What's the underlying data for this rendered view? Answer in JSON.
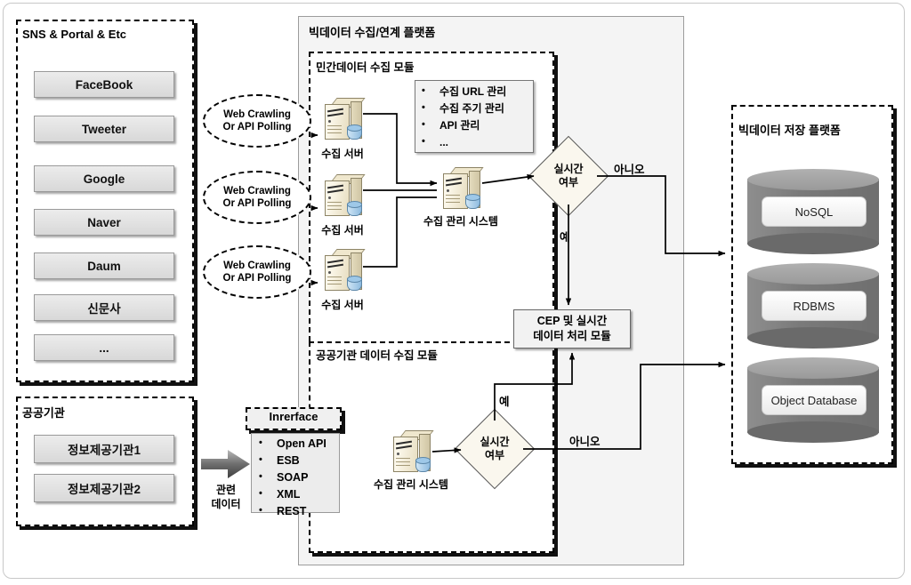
{
  "diagram": {
    "title_hidden": "빅데이터 수집/연계 플랫폼 구성도",
    "colors": {
      "server_beige": "#efe7cd",
      "db_gray": "#7a7a7a",
      "diamond_fill": "#faf7ee",
      "button_gray": "#e2e2e2"
    }
  },
  "sns_group": {
    "title": "SNS & Portal & Etc",
    "items": [
      {
        "label": "FaceBook"
      },
      {
        "label": "Tweeter"
      },
      {
        "label": "Google"
      },
      {
        "label": "Naver"
      },
      {
        "label": "Daum"
      },
      {
        "label": "신문사"
      },
      {
        "label": "..."
      }
    ]
  },
  "public_group": {
    "title": "공공기관",
    "items": [
      {
        "label": "정보제공기관1"
      },
      {
        "label": "정보제공기관2"
      }
    ]
  },
  "related_data": {
    "arrow_icon": "right-arrow-icon",
    "label_line1": "관련",
    "label_line2": "데이터"
  },
  "interface_box": {
    "title": "Inrerface",
    "items": [
      "Open API",
      "ESB",
      "SOAP",
      "XML",
      "REST"
    ]
  },
  "platform": {
    "title": "빅데이터 수집/연계 플랫폼",
    "private_module": {
      "title": "민간데이터 수집 모듈",
      "crawl_clouds": [
        {
          "line1": "Web Crawling",
          "line2": "Or API Polling"
        },
        {
          "line1": "Web Crawling",
          "line2": "Or API Polling"
        },
        {
          "line1": "Web Crawling",
          "line2": "Or API Polling"
        }
      ],
      "servers": [
        {
          "label": "수집 서버",
          "icon": "server-icon"
        },
        {
          "label": "수집 서버",
          "icon": "server-icon"
        },
        {
          "label": "수집 서버",
          "icon": "server-icon"
        }
      ],
      "manage_box": {
        "items": [
          "수집 URL 관리",
          "수집 주기 관리",
          "API 관리",
          "..."
        ]
      },
      "collect_mgmt_system": {
        "label": "수집 관리 시스템",
        "icon": "server-icon"
      },
      "decision": {
        "line1": "실시간",
        "line2": "여부"
      },
      "edge_yes": "예",
      "edge_no": "아니오"
    },
    "public_module": {
      "title": "공공기관 데이터 수집 모듈",
      "collect_mgmt_system": {
        "label": "수집 관리 시스템",
        "icon": "server-icon"
      },
      "decision": {
        "line1": "실시간",
        "line2": "여부"
      },
      "edge_yes": "예",
      "edge_no": "아니오"
    },
    "cep_module": {
      "line1": "CEP 및 실시간",
      "line2": "데이터 처리 모듈"
    }
  },
  "storage_platform": {
    "title": "빅데이터 저장 플랫폼",
    "databases": [
      {
        "label": "NoSQL",
        "icon": "database-cylinder-icon"
      },
      {
        "label": "RDBMS",
        "icon": "database-cylinder-icon"
      },
      {
        "label": "Object Database",
        "icon": "database-cylinder-icon"
      }
    ]
  }
}
